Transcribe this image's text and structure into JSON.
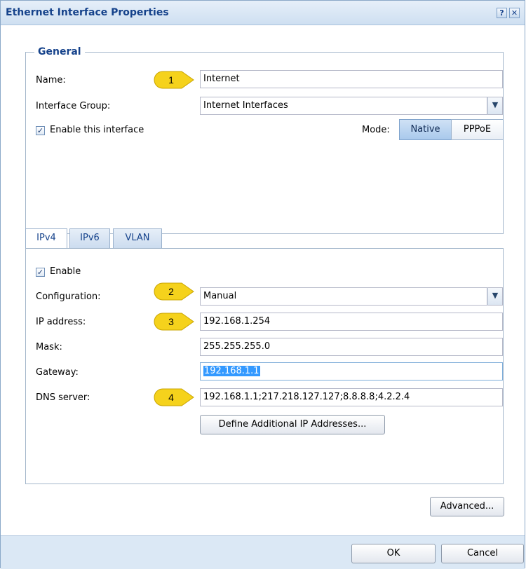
{
  "dialog": {
    "title": "Ethernet Interface Properties",
    "help_label": "?",
    "close_label": "✕"
  },
  "general": {
    "legend": "General",
    "name_label": "Name:",
    "name_value": "Internet",
    "group_label": "Interface Group:",
    "group_value": "Internet Interfaces",
    "enable_label": "Enable this interface",
    "enable_checked": true,
    "mode_label": "Mode:",
    "mode_options": [
      "Native",
      "PPPoE"
    ],
    "mode_selected": "Native"
  },
  "tabs": [
    "IPv4",
    "IPv6",
    "VLAN"
  ],
  "active_tab": "IPv4",
  "ipv4": {
    "enable_label": "Enable",
    "enable_checked": true,
    "configuration_label": "Configuration:",
    "configuration_value": "Manual",
    "ip_label": "IP address:",
    "ip_value": "192.168.1.254",
    "mask_label": "Mask:",
    "mask_value": "255.255.255.0",
    "gateway_label": "Gateway:",
    "gateway_value": "192.168.1.1",
    "dns_label": "DNS server:",
    "dns_value": "192.168.1.1;217.218.127.127;8.8.8.8;4.2.2.4",
    "define_button": "Define Additional IP Addresses..."
  },
  "callouts": [
    "1",
    "2",
    "3",
    "4"
  ],
  "buttons": {
    "advanced": "Advanced...",
    "ok": "OK",
    "cancel": "Cancel"
  },
  "colors": {
    "accent": "#15428b",
    "callout_fill": "#f5d21c",
    "selection": "#3399ff"
  }
}
